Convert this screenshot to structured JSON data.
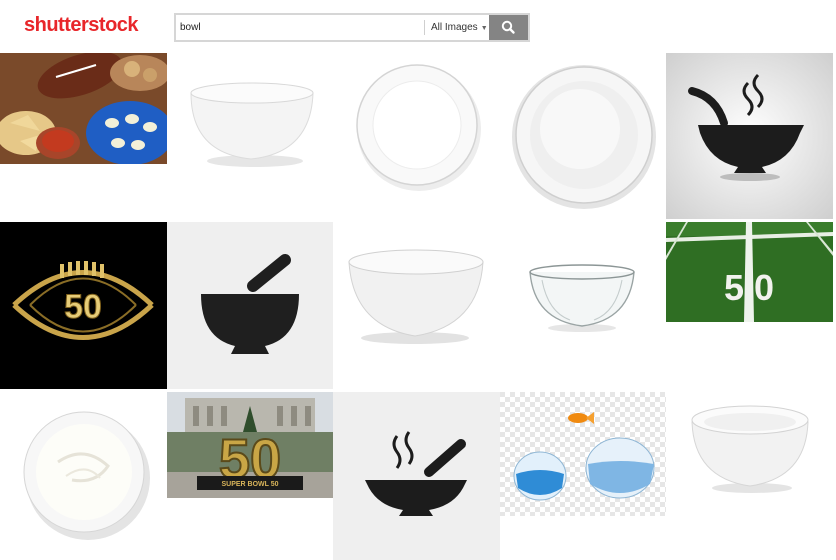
{
  "brand": {
    "logo_text": "shutterstock",
    "color": "#e8262a"
  },
  "search": {
    "query": "bowl",
    "filter_label": "All Images",
    "button_icon": "search-icon"
  },
  "results": [
    {
      "name": "snack-platter-football",
      "icon": "photo"
    },
    {
      "name": "white-bowl-side",
      "icon": "photo"
    },
    {
      "name": "white-bowl-top",
      "icon": "photo"
    },
    {
      "name": "white-plate-bowl-top",
      "icon": "photo"
    },
    {
      "name": "soup-bowl-icon",
      "icon": "soup-bowl-icon"
    },
    {
      "name": "football-50-gold",
      "icon": "football-icon",
      "text": "50"
    },
    {
      "name": "mortar-pestle-icon",
      "icon": "mortar-pestle-icon"
    },
    {
      "name": "white-ceramic-bowl",
      "icon": "photo"
    },
    {
      "name": "glass-bowl",
      "icon": "photo"
    },
    {
      "name": "football-field-50",
      "icon": "photo",
      "text": "5 0"
    },
    {
      "name": "cream-bowl",
      "icon": "photo"
    },
    {
      "name": "super-bowl-50-sculpture",
      "icon": "photo",
      "text": "50",
      "caption": "SUPER BOWL 50"
    },
    {
      "name": "mortar-steam-icon",
      "icon": "soup-bowl-icon"
    },
    {
      "name": "goldfish-jump-bowls",
      "icon": "photo"
    },
    {
      "name": "white-bowl-angle",
      "icon": "photo"
    }
  ]
}
